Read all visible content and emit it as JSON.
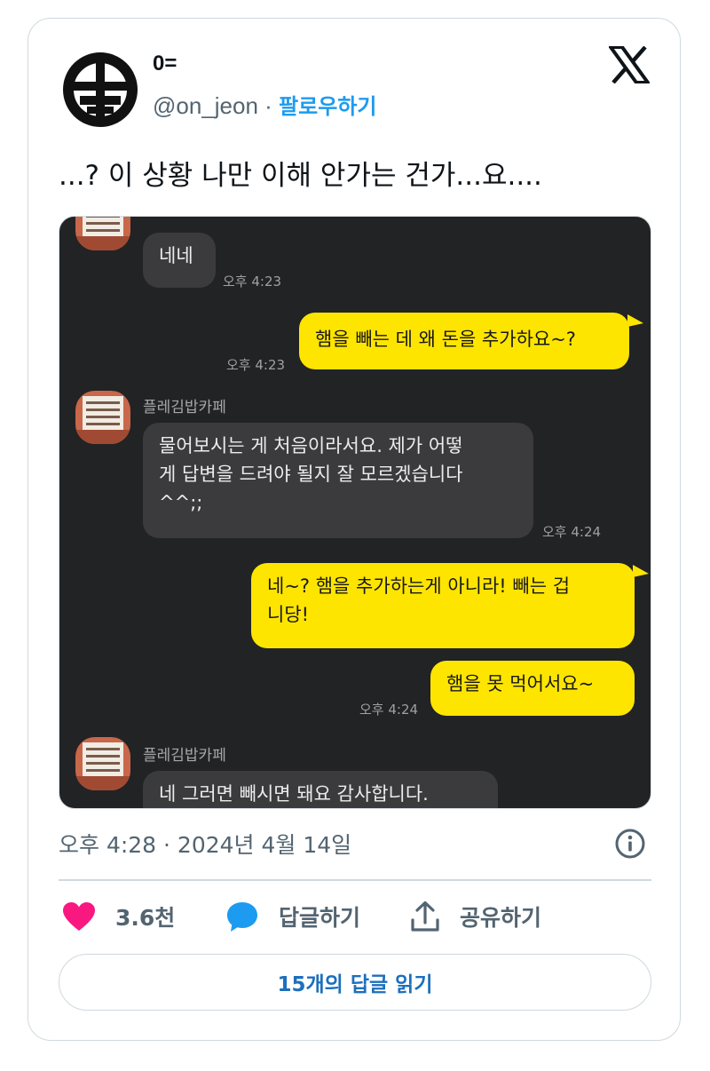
{
  "author": {
    "display_name": "0=",
    "handle": "@on_jeon",
    "separator": "·",
    "follow_label": "팔로우하기"
  },
  "tweet": {
    "text": "...? 이 상황 나만 이해 안가는 건가...요....",
    "timestamp": "오후 4:28 · 2024년 4월 14일"
  },
  "chat": {
    "partner_name": "플레김밥카페",
    "messages": [
      {
        "side": "in",
        "text": "네네",
        "time": "오후 4:23"
      },
      {
        "side": "out",
        "text": "햄을 빼는 데 왜 돈을 추가하요~?",
        "time": "오후 4:23"
      },
      {
        "side": "in",
        "text": "물어보시는 게 처음이라서요. 제가 어떻\n게 답변을 드려야 될지 잘 모르겠습니다\n^^;;",
        "time": "오후 4:24"
      },
      {
        "side": "out",
        "text": "네~? 햄을 추가하는게 아니라! 빼는 겁\n니당!",
        "time": ""
      },
      {
        "side": "out",
        "text": "햄을 못 먹어서요~",
        "time": "오후 4:24"
      },
      {
        "side": "in",
        "text": "네 그러면  빼시면 돼요 감사합니다.",
        "time": ""
      }
    ]
  },
  "actions": {
    "likes_count": "3.6천",
    "reply_label": "답글하기",
    "share_label": "공유하기",
    "read_replies_label": "15개의 답글 읽기"
  },
  "colors": {
    "accent": "#1d9bf0",
    "like": "#f91880",
    "kakao_yellow": "#fee500",
    "chat_bg": "#222325"
  }
}
